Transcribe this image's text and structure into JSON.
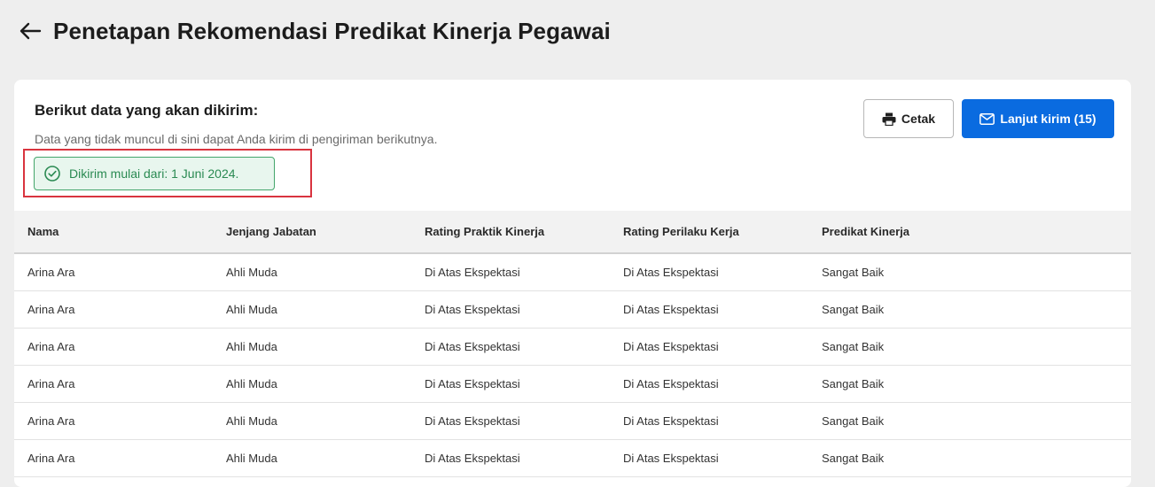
{
  "header": {
    "back_icon": "arrow-left-icon",
    "title": "Penetapan Rekomendasi Predikat Kinerja Pegawai"
  },
  "info": {
    "title": "Berikut data yang akan dikirim:",
    "subtitle": "Data yang tidak muncul di sini dapat Anda kirim di pengiriman berikutnya.",
    "badge_icon": "check-circle-icon",
    "badge_text": "Dikirim mulai dari: 1 Juni 2024.",
    "badge_color": "#2a8a52",
    "highlight_color": "#d9343f"
  },
  "actions": {
    "print_icon": "printer-icon",
    "print_label": "Cetak",
    "send_icon": "mail-icon",
    "send_label": "Lanjut kirim (15)",
    "send_color": "#0a6be0"
  },
  "table": {
    "columns": [
      "Nama",
      "Jenjang Jabatan",
      "Rating Praktik Kinerja",
      "Rating Perilaku Kerja",
      "Predikat Kinerja"
    ],
    "rows": [
      [
        "Arina Ara",
        "Ahli Muda",
        "Di Atas Ekspektasi",
        "Di Atas Ekspektasi",
        "Sangat Baik"
      ],
      [
        "Arina Ara",
        "Ahli Muda",
        "Di Atas Ekspektasi",
        "Di Atas Ekspektasi",
        "Sangat Baik"
      ],
      [
        "Arina Ara",
        "Ahli Muda",
        "Di Atas Ekspektasi",
        "Di Atas Ekspektasi",
        "Sangat Baik"
      ],
      [
        "Arina Ara",
        "Ahli Muda",
        "Di Atas Ekspektasi",
        "Di Atas Ekspektasi",
        "Sangat Baik"
      ],
      [
        "Arina Ara",
        "Ahli Muda",
        "Di Atas Ekspektasi",
        "Di Atas Ekspektasi",
        "Sangat Baik"
      ],
      [
        "Arina Ara",
        "Ahli Muda",
        "Di Atas Ekspektasi",
        "Di Atas Ekspektasi",
        "Sangat Baik"
      ]
    ]
  }
}
